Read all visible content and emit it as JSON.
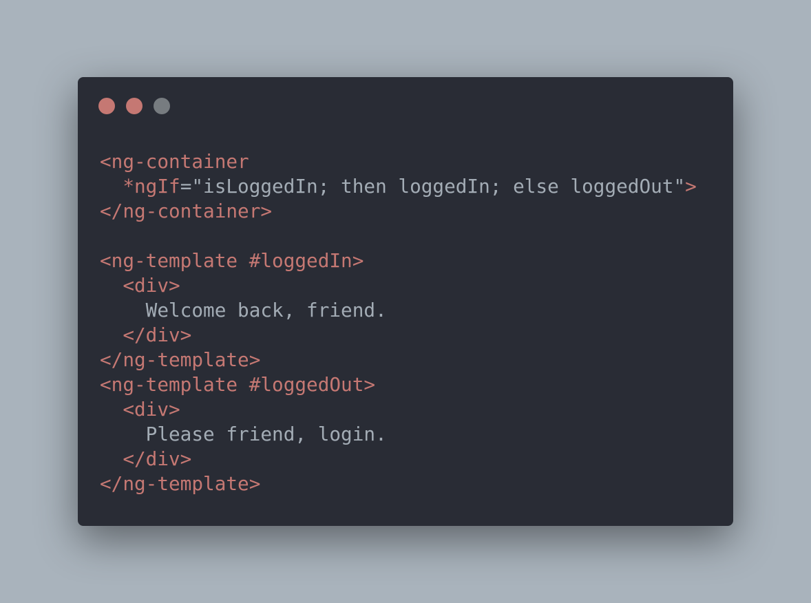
{
  "colors": {
    "tag": "#c57873",
    "text": "#a3acb5",
    "background": "#292c35",
    "page": "#a9b3bc"
  },
  "window_controls": [
    "close-dot",
    "minimize-dot",
    "maximize-dot"
  ],
  "code_lines": [
    [
      {
        "t": "<ng-container",
        "c": "red"
      }
    ],
    [
      {
        "t": "  *ngIf",
        "c": "red"
      },
      {
        "t": "=\"isLoggedIn; then loggedIn; else loggedOut\"",
        "c": "gray"
      },
      {
        "t": ">",
        "c": "red"
      }
    ],
    [
      {
        "t": "</ng-container>",
        "c": "red"
      }
    ],
    [],
    [
      {
        "t": "<ng-template #loggedIn>",
        "c": "red"
      }
    ],
    [
      {
        "t": "  <div>",
        "c": "red"
      }
    ],
    [
      {
        "t": "    Welcome back, friend.",
        "c": "gray"
      }
    ],
    [
      {
        "t": "  </div>",
        "c": "red"
      }
    ],
    [
      {
        "t": "</ng-template>",
        "c": "red"
      }
    ],
    [
      {
        "t": "<ng-template #loggedOut>",
        "c": "red"
      }
    ],
    [
      {
        "t": "  <div>",
        "c": "red"
      }
    ],
    [
      {
        "t": "    Please friend, login.",
        "c": "gray"
      }
    ],
    [
      {
        "t": "  </div>",
        "c": "red"
      }
    ],
    [
      {
        "t": "</ng-template>",
        "c": "red"
      }
    ]
  ]
}
